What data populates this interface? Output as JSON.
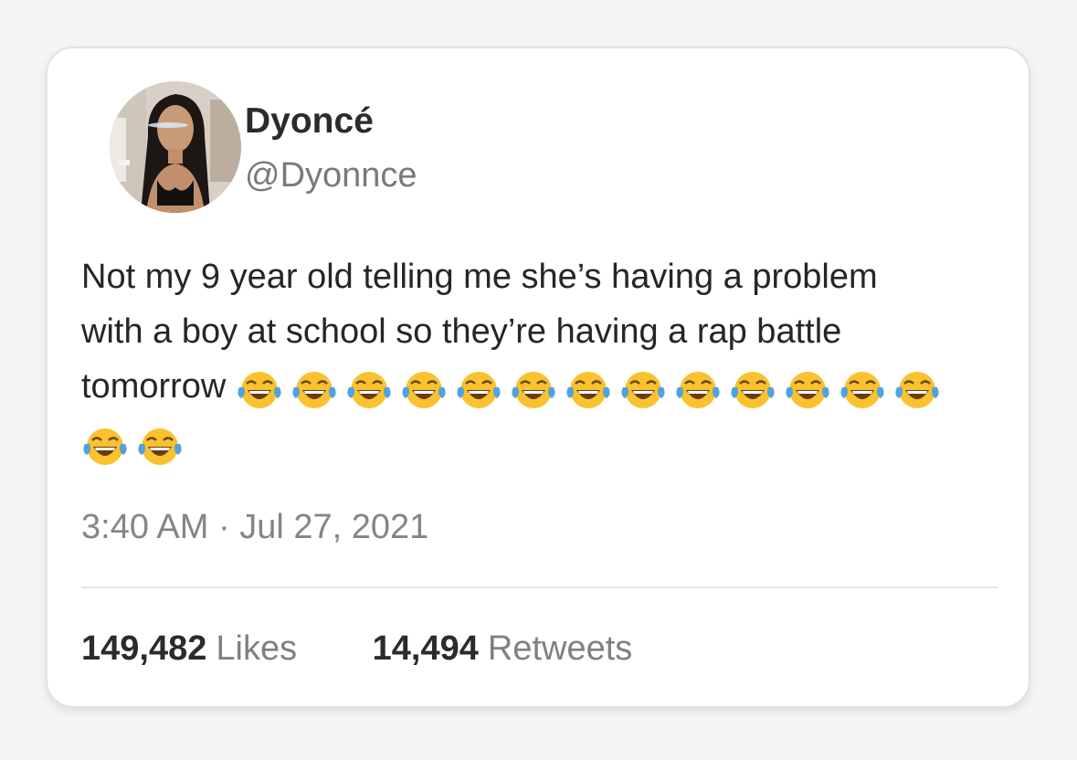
{
  "tweet": {
    "author_name": "Dyoncé",
    "handle": "@Dyonnce",
    "text_lines": [
      "Not my 9 year old telling me she’s having a problem",
      "with a boy at school so they’re having a rap battle",
      "tomorrow"
    ],
    "emoji_icon": "face-with-tears-of-joy",
    "emoji_count": 15,
    "time": "3:40 AM",
    "separator": "·",
    "date": "Jul 27, 2021",
    "likes_count": "149,482",
    "likes_label": "Likes",
    "retweets_count": "14,494",
    "retweets_label": "Retweets"
  },
  "colors": {
    "background": "#f5f5f5",
    "card": "#ffffff",
    "name": "#2b2b2b",
    "secondary": "#7a7a7a",
    "emoji_face": "#f9c22e",
    "emoji_tears": "#4fa3e0"
  }
}
